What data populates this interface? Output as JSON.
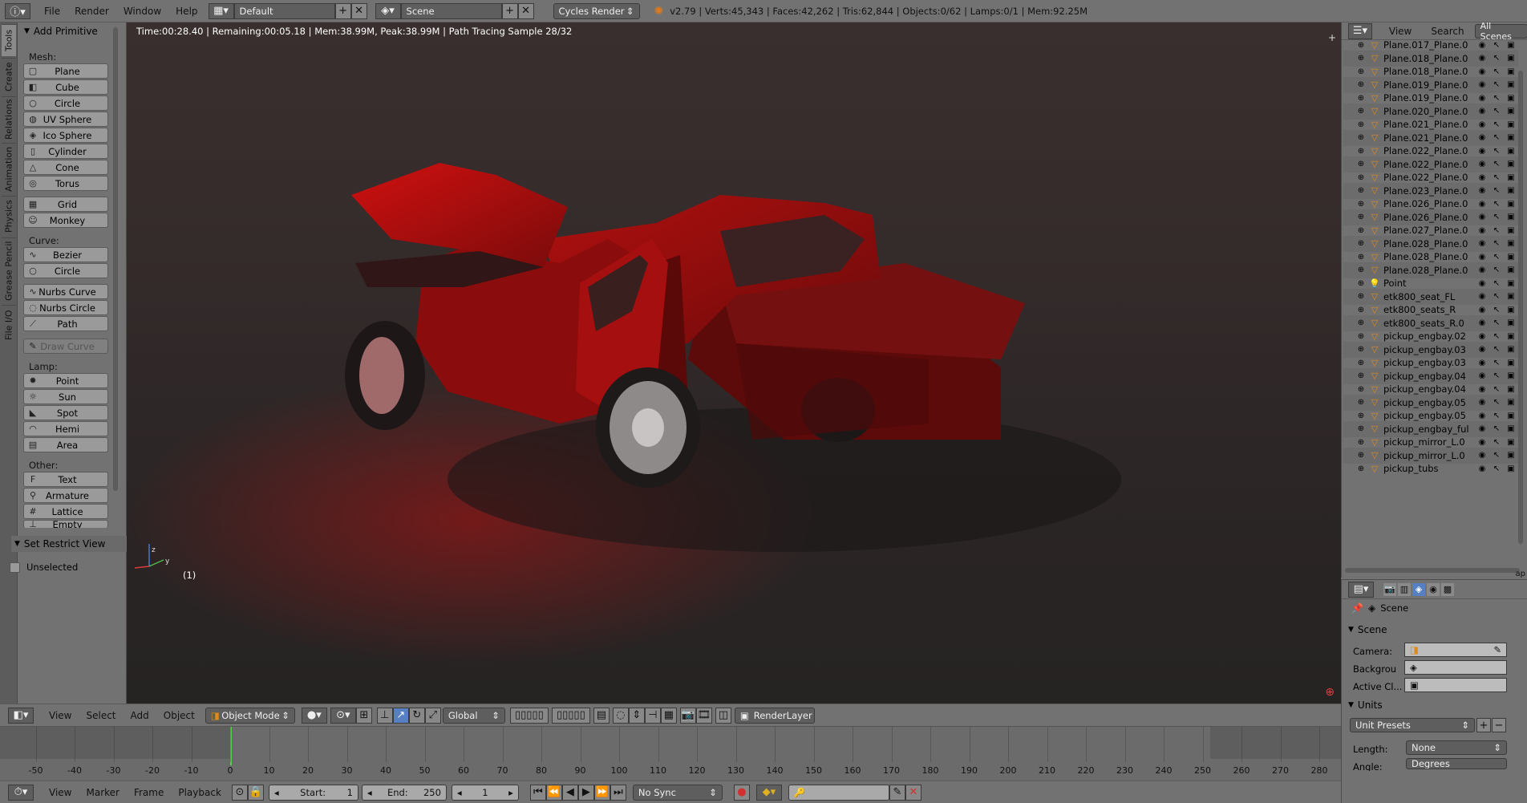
{
  "topbar": {
    "menus": [
      "File",
      "Render",
      "Window",
      "Help"
    ],
    "layout": "Default",
    "scene": "Scene",
    "engine": "Cycles Render",
    "stats": "v2.79 | Verts:45,343 | Faces:42,262 | Tris:62,844 | Objects:0/62 | Lamps:0/1 | Mem:92.25M"
  },
  "tabs": [
    "Tools",
    "Create",
    "Relations",
    "Animation",
    "Physics",
    "Grease Pencil",
    "File I/O"
  ],
  "toolshelf": {
    "title": "Add Primitive",
    "mesh_label": "Mesh:",
    "mesh": [
      "Plane",
      "Cube",
      "Circle",
      "UV Sphere",
      "Ico Sphere",
      "Cylinder",
      "Cone",
      "Torus"
    ],
    "mesh2": [
      "Grid",
      "Monkey"
    ],
    "curve_label": "Curve:",
    "curve": [
      "Bezier",
      "Circle"
    ],
    "curve2": [
      "Nurbs Curve",
      "Nurbs Circle",
      "Path"
    ],
    "draw_curve": "Draw Curve",
    "lamp_label": "Lamp:",
    "lamp": [
      "Point",
      "Sun",
      "Spot",
      "Hemi",
      "Area"
    ],
    "other_label": "Other:",
    "other": [
      "Text",
      "Armature",
      "Lattice",
      "Empty"
    ],
    "restrict_title": "Set Restrict View",
    "unselected": "Unselected"
  },
  "viewport": {
    "info": "Time:00:28.40 | Remaining:00:05.18 | Mem:38.99M, Peak:38.99M | Path Tracing Sample 28/32",
    "frame": "(1)"
  },
  "outliner": {
    "menus": [
      "View",
      "Search",
      "All Scenes"
    ],
    "items": [
      "Plane.017_Plane.0",
      "Plane.018_Plane.0",
      "Plane.018_Plane.0",
      "Plane.019_Plane.0",
      "Plane.019_Plane.0",
      "Plane.020_Plane.0",
      "Plane.021_Plane.0",
      "Plane.021_Plane.0",
      "Plane.022_Plane.0",
      "Plane.022_Plane.0",
      "Plane.022_Plane.0",
      "Plane.023_Plane.0",
      "Plane.026_Plane.0",
      "Plane.026_Plane.0",
      "Plane.027_Plane.0",
      "Plane.028_Plane.0",
      "Plane.028_Plane.0",
      "Plane.028_Plane.0",
      "Point",
      "etk800_seat_FL",
      "etk800_seats_R",
      "etk800_seats_R.0",
      "pickup_engbay.02",
      "pickup_engbay.03",
      "pickup_engbay.03",
      "pickup_engbay.04",
      "pickup_engbay.04",
      "pickup_engbay.05",
      "pickup_engbay.05",
      "pickup_engbay_ful",
      "pickup_mirror_L.0",
      "pickup_mirror_L.0",
      "pickup_tubs"
    ],
    "corner": "ap"
  },
  "properties": {
    "context": "Scene",
    "panel_scene": "Scene",
    "camera_label": "Camera:",
    "background_label": "Backgrou",
    "active_clip_label": "Active Cl...",
    "panel_units": "Units",
    "unit_presets": "Unit Presets",
    "length_label": "Length:",
    "length_value": "None",
    "angle_label": "Angle:",
    "angle_value": "Degrees"
  },
  "vphead": {
    "menus": [
      "View",
      "Select",
      "Add",
      "Object"
    ],
    "mode": "Object Mode",
    "orientation": "Global",
    "render_layer": "RenderLayer"
  },
  "timeline": {
    "ticks": [
      "-50",
      "-40",
      "-30",
      "-20",
      "-10",
      "0",
      "10",
      "20",
      "30",
      "40",
      "50",
      "60",
      "70",
      "80",
      "90",
      "100",
      "110",
      "120",
      "130",
      "140",
      "150",
      "160",
      "170",
      "180",
      "190",
      "200",
      "210",
      "220",
      "230",
      "240",
      "250",
      "260",
      "270",
      "280"
    ],
    "menus": [
      "View",
      "Marker",
      "Frame",
      "Playback"
    ],
    "start_label": "Start:",
    "start": "1",
    "end_label": "End:",
    "end": "250",
    "current": "1",
    "sync": "No Sync"
  }
}
